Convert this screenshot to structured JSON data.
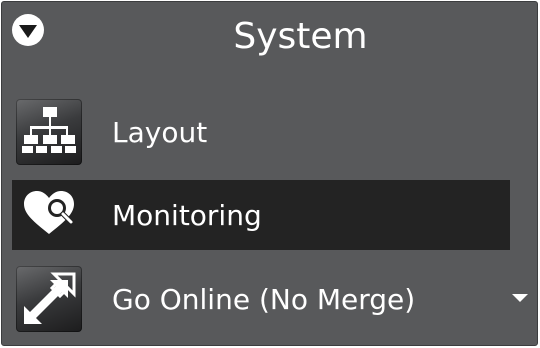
{
  "panel": {
    "title": "System",
    "collapse_icon": "chevron-down-circle-icon"
  },
  "items": [
    {
      "label": "Layout",
      "icon": "network-layout-icon",
      "selected": false
    },
    {
      "label": "Monitoring",
      "icon": "heart-magnifier-icon",
      "selected": true
    },
    {
      "label": "Go Online (No Merge)",
      "icon": "expand-arrows-icon",
      "selected": false,
      "has_dropdown": true
    }
  ],
  "colors": {
    "panel_bg": "#58595b",
    "selected_bg": "#232323",
    "text": "#ffffff"
  }
}
